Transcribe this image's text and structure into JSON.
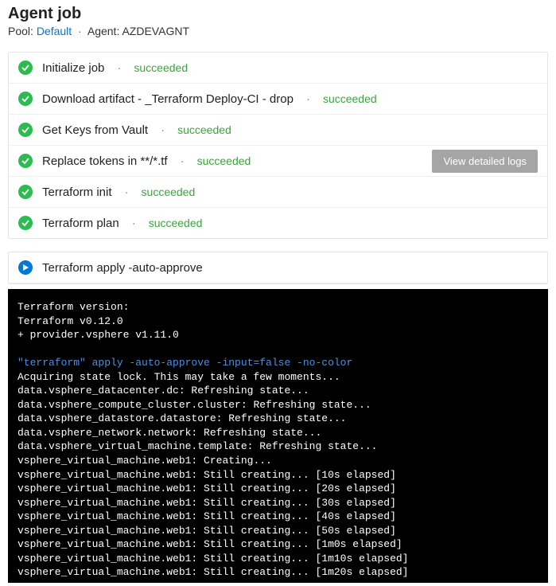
{
  "header": {
    "title": "Agent job",
    "poolLabel": "Pool:",
    "poolLink": "Default",
    "agentLabel": "Agent:",
    "agentName": "AZDEVAGNT"
  },
  "statuses": {
    "succeeded": "succeeded"
  },
  "logsButton": "View detailed logs",
  "steps": [
    {
      "label": "Initialize job",
      "status": "succeeded",
      "showButton": false
    },
    {
      "label": "Download artifact - _Terraform Deploy-CI - drop",
      "status": "succeeded",
      "showButton": false
    },
    {
      "label": "Get Keys from Vault",
      "status": "succeeded",
      "showButton": false
    },
    {
      "label": "Replace tokens in **/*.tf",
      "status": "succeeded",
      "showButton": true
    },
    {
      "label": "Terraform init",
      "status": "succeeded",
      "showButton": false
    },
    {
      "label": "Terraform plan",
      "status": "succeeded",
      "showButton": false
    }
  ],
  "runningStep": {
    "label": "Terraform apply -auto-approve"
  },
  "terminal": {
    "preLines": [
      "Terraform version:",
      "Terraform v0.12.0",
      "+ provider.vsphere v1.11.0",
      ""
    ],
    "cmd": "\"terraform\" apply -auto-approve -input=false -no-color",
    "postLines": [
      "Acquiring state lock. This may take a few moments...",
      "data.vsphere_datacenter.dc: Refreshing state...",
      "data.vsphere_compute_cluster.cluster: Refreshing state...",
      "data.vsphere_datastore.datastore: Refreshing state...",
      "data.vsphere_network.network: Refreshing state...",
      "data.vsphere_virtual_machine.template: Refreshing state...",
      "vsphere_virtual_machine.web1: Creating...",
      "vsphere_virtual_machine.web1: Still creating... [10s elapsed]",
      "vsphere_virtual_machine.web1: Still creating... [20s elapsed]",
      "vsphere_virtual_machine.web1: Still creating... [30s elapsed]",
      "vsphere_virtual_machine.web1: Still creating... [40s elapsed]",
      "vsphere_virtual_machine.web1: Still creating... [50s elapsed]",
      "vsphere_virtual_machine.web1: Still creating... [1m0s elapsed]",
      "vsphere_virtual_machine.web1: Still creating... [1m10s elapsed]",
      "vsphere_virtual_machine.web1: Still creating... [1m20s elapsed]"
    ]
  }
}
